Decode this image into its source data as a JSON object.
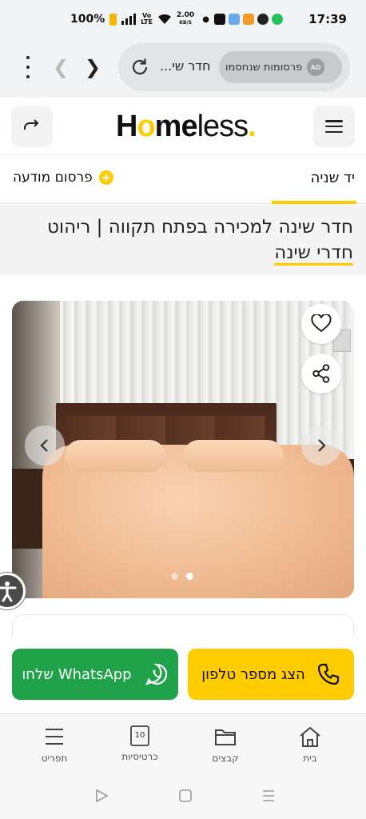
{
  "status_bar": {
    "battery": "100%",
    "volte": "Vo LTE",
    "speed_value": "2.00",
    "speed_unit": "KB/S",
    "time": "17:39"
  },
  "browser": {
    "url_text": "חדר שי...",
    "ad_block_badge": "AD",
    "ad_block_text": "פרסומות שנחסמו"
  },
  "site": {
    "logo_home_1": "H",
    "logo_home_o": "o",
    "logo_home_2": "me",
    "logo_less": "less",
    "logo_dot": "."
  },
  "tabs": {
    "active_label": "יד שניה",
    "post_ad_label": "פרסום מודעה"
  },
  "listing": {
    "title_main": "חדר שינה למכירה בפתח תקווה | ריהוט",
    "title_category": "חדרי שינה",
    "image_count": 2,
    "current_image_index": 2
  },
  "actions": {
    "whatsapp_label": "שלחו WhatsApp",
    "phone_label": "הצג מספר טלפון"
  },
  "bottom_nav": {
    "items": [
      {
        "label": "בית",
        "icon": "home-icon"
      },
      {
        "label": "קבצים",
        "icon": "folder-icon"
      },
      {
        "label": "כרטיסיות",
        "icon": "tabs-count-icon",
        "count": "10"
      },
      {
        "label": "תפריט",
        "icon": "menu-icon"
      }
    ]
  },
  "colors": {
    "accent": "#ffcc00",
    "whatsapp": "#1fa24a",
    "background": "#ffffff"
  }
}
